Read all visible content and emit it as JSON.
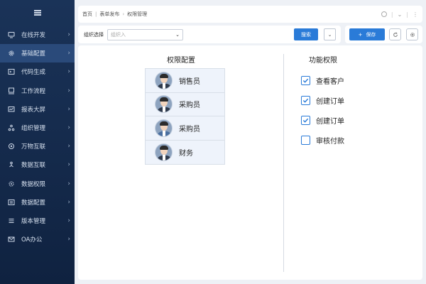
{
  "sidebar": {
    "items": [
      {
        "label": "在线开发",
        "icon": "monitor-icon",
        "active": false
      },
      {
        "label": "基础配置",
        "icon": "gear-icon",
        "active": true
      },
      {
        "label": "代码生成",
        "icon": "code-icon",
        "active": false
      },
      {
        "label": "工作流程",
        "icon": "workflow-icon",
        "active": false
      },
      {
        "label": "报表大屏",
        "icon": "chart-screen-icon",
        "active": false
      },
      {
        "label": "组织管理",
        "icon": "org-icon",
        "active": false
      },
      {
        "label": "万物互联",
        "icon": "iot-icon",
        "active": false
      },
      {
        "label": "数据互联",
        "icon": "data-link-icon",
        "active": false
      },
      {
        "label": "数据权限",
        "icon": "data-permission-icon",
        "active": false
      },
      {
        "label": "数据配置",
        "icon": "data-config-icon",
        "active": false
      },
      {
        "label": "版本管理",
        "icon": "version-icon",
        "active": false
      },
      {
        "label": "OA办公",
        "icon": "mail-icon",
        "active": false
      }
    ]
  },
  "breadcrumb": {
    "items": [
      "首页",
      "表单发布",
      "权限管理"
    ]
  },
  "filter": {
    "label": "组织选择",
    "placeholder": "组织入",
    "search_label": "搜索"
  },
  "actions": {
    "save_label": "保存",
    "save_prefix": "+"
  },
  "main": {
    "left_title": "权限配置",
    "right_title": "功能权限",
    "roles": [
      {
        "name": "销售员",
        "avatar": "avatar-icon"
      },
      {
        "name": "采购员",
        "avatar": "avatar-icon"
      },
      {
        "name": "采购员",
        "avatar": "avatar-icon"
      },
      {
        "name": "财务",
        "avatar": "avatar-icon"
      }
    ],
    "permissions": [
      {
        "label": "查看客户",
        "checked": true
      },
      {
        "label": "创建订单",
        "checked": true
      },
      {
        "label": "创建订单",
        "checked": true
      },
      {
        "label": "审核付款",
        "checked": false
      }
    ]
  },
  "colors": {
    "primary": "#2a7bd8",
    "sidebar_bg": "#1a3358"
  }
}
